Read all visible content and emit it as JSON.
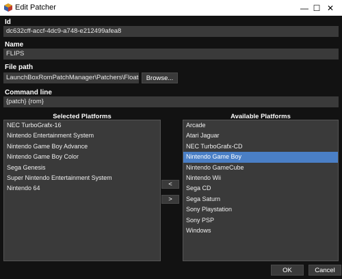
{
  "window": {
    "title": "Edit Patcher",
    "controls": {
      "minimize": "—",
      "maximize": "☐",
      "close": "✕"
    }
  },
  "fields": {
    "id_label": "Id",
    "id_value": "dc632cff-accf-4dc9-a748-e212499afea8",
    "name_label": "Name",
    "name_value": "FLIPS",
    "filepath_label": "File path",
    "filepath_value": "LaunchBoxRomPatchManager\\Patchers\\Floating\\flips.exe",
    "browse_label": "Browse...",
    "cmdline_label": "Command line",
    "cmdline_value": "{patch} {rom}"
  },
  "selected_platforms": {
    "title": "Selected Platforms",
    "items": [
      "NEC TurboGrafx-16",
      "Nintendo Entertainment System",
      "Nintendo Game Boy Advance",
      "Nintendo Game Boy Color",
      "Sega Genesis",
      "Super Nintendo Entertainment System",
      "Nintendo 64"
    ]
  },
  "available_platforms": {
    "title": "Available Platforms",
    "items": [
      "Arcade",
      "Atari Jaguar",
      "NEC TurboGrafx-CD",
      "Nintendo Game Boy",
      "Nintendo GameCube",
      "Nintendo Wii",
      "Sega CD",
      "Sega Saturn",
      "Sony Playstation",
      "Sony PSP",
      "Windows"
    ],
    "selected_index": 3
  },
  "move_buttons": {
    "add": "<",
    "remove": ">"
  },
  "footer": {
    "ok": "OK",
    "cancel": "Cancel"
  },
  "colors": {
    "selection": "#4a7fc6",
    "background": "#121212",
    "field": "#3a3a3a"
  }
}
